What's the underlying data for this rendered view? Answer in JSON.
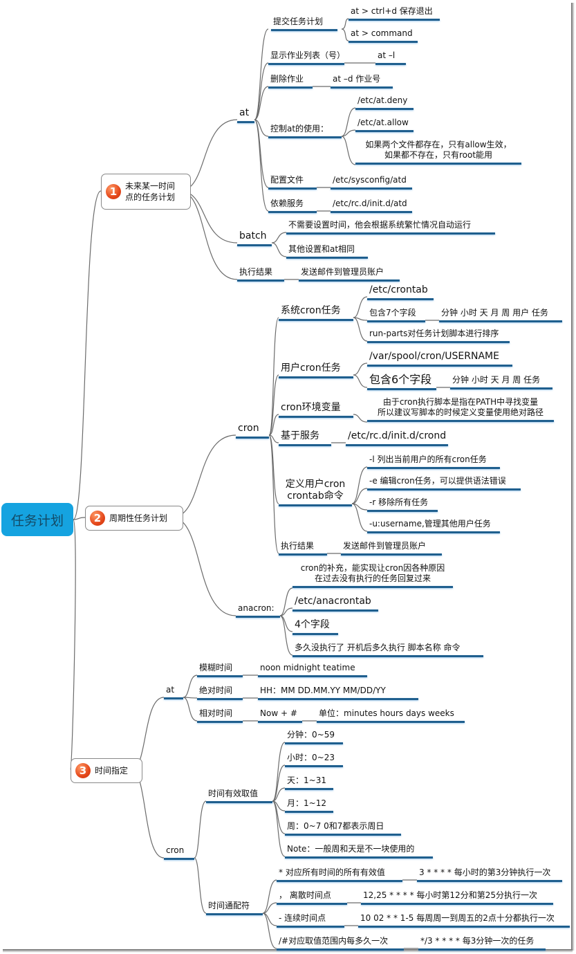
{
  "root": {
    "label": "任务计划",
    "color": "#15a3e0"
  },
  "branch1": {
    "badge": "1",
    "label_line1": "未来某一时间",
    "label_line2": "点的任务计划",
    "at": {
      "label": "at",
      "submit": {
        "label": "提交任务计划",
        "children": [
          "at > ctrl+d 保存退出",
          "at > command"
        ]
      },
      "list": {
        "label": "显示作业列表（号）",
        "value": "at  –l"
      },
      "delete": {
        "label": "删除作业",
        "value": "at  –d 作业号"
      },
      "control": {
        "label": "控制at的使用：",
        "children": [
          "/etc/at.deny",
          "/etc/at.allow"
        ],
        "note_line1": "如果两个文件都存在，只有allow生效，",
        "note_line2": "如果都不存在，只有root能用"
      },
      "config": {
        "label": "配置文件",
        "value": "/etc/sysconfig/atd"
      },
      "service": {
        "label": "依赖服务",
        "value": "/etc/rc.d/init.d/atd"
      }
    },
    "batch": {
      "label": "batch",
      "children": [
        "不需要设置时间，他会根据系统繁忙情况自动运行",
        "其他设置和at相同"
      ]
    },
    "result": {
      "label": "执行结果",
      "value": "发送邮件到管理员账户"
    }
  },
  "branch2": {
    "badge": "2",
    "label": "周期性任务计划",
    "cron": {
      "label": "cron",
      "system": {
        "label": "系统cron任务",
        "file": "/etc/crontab",
        "fields_label": "包含7个字段",
        "fields_value": "分钟  小时  天  月  周  用户  任务",
        "runparts": "run-parts对任务计划脚本进行排序"
      },
      "user": {
        "label": "用户cron任务",
        "file": "/var/spool/cron/USERNAME",
        "fields_label": "包含6个字段",
        "fields_value": "分钟  小时  天  月  周  任务"
      },
      "env": {
        "label": "cron环境变量",
        "note_line1": "由于cron执行脚本是指在PATH中寻找变量",
        "note_line2": "所以建议写脚本的时候定义变量使用绝对路径"
      },
      "service": {
        "label": "基于服务",
        "value": "/etc/rc.d/init.d/crond"
      },
      "crontab": {
        "label_line1": "定义用户cron",
        "label_line2": "crontab命令",
        "options": [
          "-l 列出当前用户的所有cron任务",
          "-e 编辑cron任务，可以提供语法错误",
          "-r 移除所有任务",
          "-u:username,管理其他用户任务"
        ]
      },
      "result": {
        "label": "执行结果",
        "value": "发送邮件到管理员账户"
      }
    },
    "anacron": {
      "label": "anacron:",
      "note_line1": "cron的补充，能实现让cron因各种原因",
      "note_line2": "在过去没有执行的任务回复过来",
      "file": "/etc/anacrontab",
      "fields_label": "4个字段",
      "fields_value": "多久没执行了  开机后多久执行   脚本名称  命令"
    }
  },
  "branch3": {
    "badge": "3",
    "label": "时间指定",
    "at": {
      "label": "at",
      "rows": [
        {
          "label": "模糊时间",
          "value": "noon    midnight  teatime"
        },
        {
          "label": "绝对时间",
          "value": "HH：MM       DD.MM.YY  MM/DD/YY"
        },
        {
          "label": "相对时间",
          "value": "Now + #",
          "extra": "单位：minutes  hours days weeks"
        }
      ]
    },
    "cron": {
      "label": "cron",
      "valid": {
        "label": "时间有效取值",
        "items": [
          "分钟：0~59",
          "小时：0~23",
          "天：1~31",
          "月：1~12",
          "周：0~7    0和7都表示周日",
          "Note：一般周和天是不一块使用的"
        ]
      },
      "wildcards": {
        "label": "时间通配符",
        "rows": [
          {
            "label": "* 对应所有时间的所有有效值",
            "value": "3 * * * * 每小时的第3分钟执行一次"
          },
          {
            "label": "，  离散时间点",
            "value": "12,25 * * * *  每小时第12分和第25分执行一次"
          },
          {
            "label": "-   连续时间点",
            "value": "10 02 * * 1-5 每周周一到周五的2点十分都执行一次"
          },
          {
            "label": "/#对应取值范围内每多久一次",
            "value": "*/3 * * * *   每3分钟一次的任务"
          }
        ]
      }
    }
  },
  "colors": {
    "underline": "#1f5f8e",
    "connector": "#6b6b6b",
    "badge": "#e4471a"
  }
}
